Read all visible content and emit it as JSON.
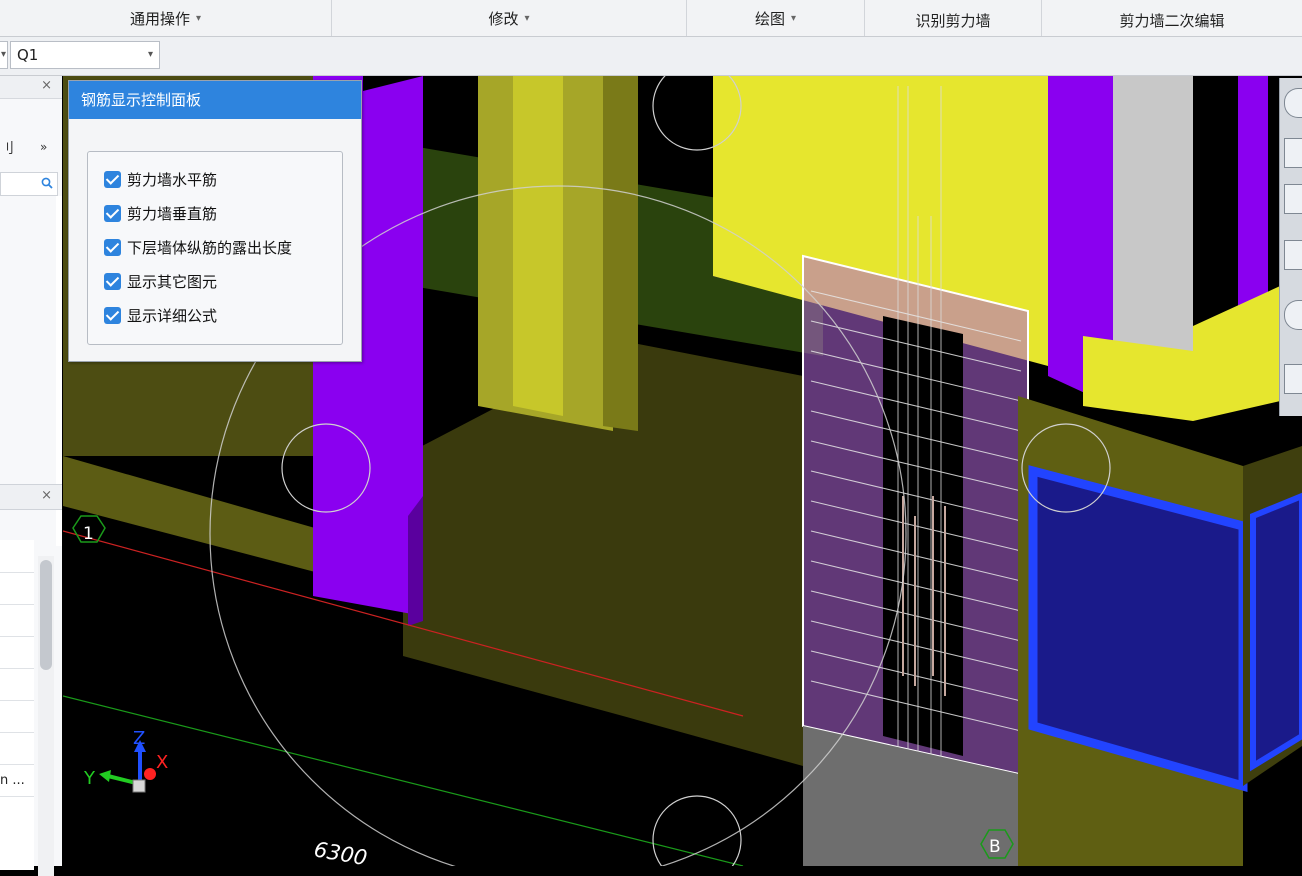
{
  "ribbon": {
    "groups": [
      {
        "label": "通用操作",
        "has_dropdown": true
      },
      {
        "label": "修改",
        "has_dropdown": true
      },
      {
        "label": "绘图",
        "has_dropdown": true
      },
      {
        "label": "识别剪力墙",
        "has_dropdown": false
      },
      {
        "label": "剪力墙二次编辑",
        "has_dropdown": false
      }
    ],
    "caret": "▾"
  },
  "toolbar": {
    "component_select": {
      "value": "Q1"
    },
    "caret": "▾"
  },
  "left_panel": {
    "close": "×",
    "row_label": "刂",
    "more": "»",
    "truncated_item": "n ..."
  },
  "rebar_panel": {
    "title": "钢筋显示控制面板",
    "options": [
      {
        "label": "剪力墙水平筋",
        "checked": true
      },
      {
        "label": "剪力墙垂直筋",
        "checked": true
      },
      {
        "label": "下层墙体纵筋的露出长度",
        "checked": true
      },
      {
        "label": "显示其它图元",
        "checked": true
      },
      {
        "label": "显示详细公式",
        "checked": true
      }
    ]
  },
  "viewport": {
    "axis_labels": {
      "x": "X",
      "y": "Y",
      "z": "Z"
    },
    "grid_labels": {
      "axis_1": "1",
      "axis_b": "B"
    },
    "dimension": "6300"
  },
  "colors": {
    "accent": "#2e84de",
    "purple_wall": "#8a00f0",
    "yellow_wall": "#e6e62e",
    "olive": "#6d6d1e",
    "blue_frame": "#2244ff",
    "background": "#000000"
  }
}
